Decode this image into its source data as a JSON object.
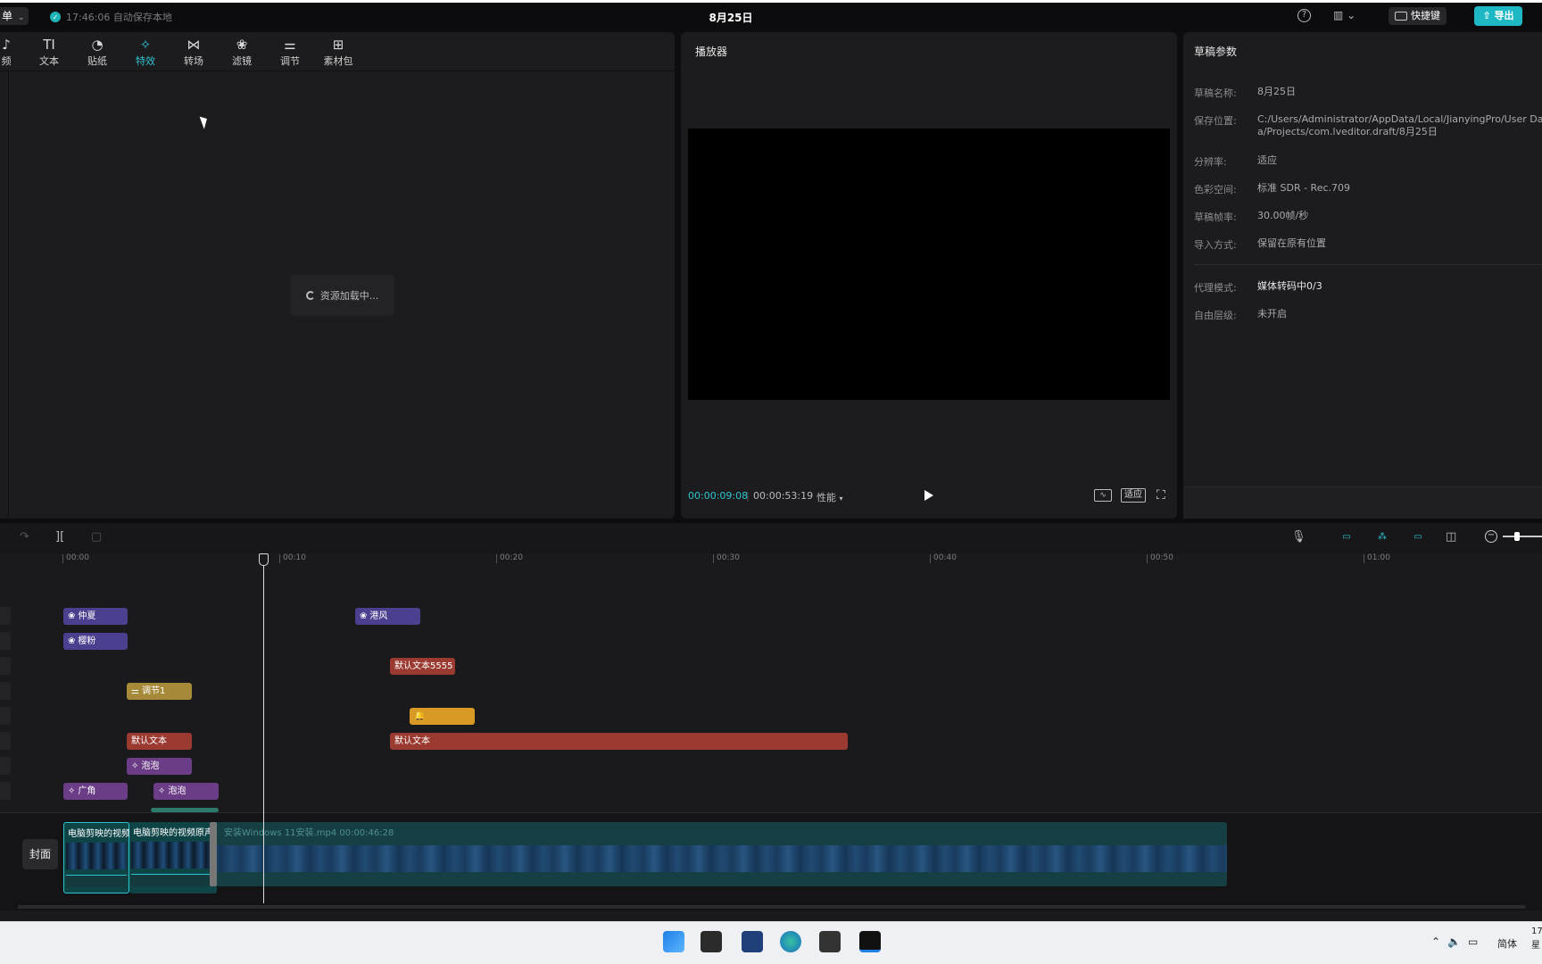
{
  "titlebar": {
    "menu_label": "单",
    "autosave_text": "17:46:06 自动保存本地",
    "project_title": "8月25日",
    "shortcut_label": "快捷键",
    "export_label": "导出"
  },
  "tabs": [
    {
      "label": "频",
      "icon": "audio-icon"
    },
    {
      "label": "文本",
      "icon": "text-icon"
    },
    {
      "label": "贴纸",
      "icon": "sticker-icon"
    },
    {
      "label": "特效",
      "icon": "effects-icon",
      "active": true
    },
    {
      "label": "转场",
      "icon": "transition-icon"
    },
    {
      "label": "滤镜",
      "icon": "filter-icon"
    },
    {
      "label": "调节",
      "icon": "adjust-icon"
    },
    {
      "label": "素材包",
      "icon": "package-icon"
    }
  ],
  "left_panel": {
    "loading_text": "资源加载中..."
  },
  "player": {
    "title": "播放器",
    "current_time": "00:00:09:08",
    "total_time": "00:00:53:19",
    "perf_label": "性能",
    "fit_label": "适应"
  },
  "draft": {
    "title": "草稿参数",
    "rows": [
      {
        "key": "草稿名称:",
        "value": "8月25日"
      },
      {
        "key": "保存位置:",
        "value": "C:/Users/Administrator/AppData/Local/JianyingPro/User Data/Projects/com.lveditor.draft/8月25日"
      },
      {
        "key": "分辨率:",
        "value": "适应"
      },
      {
        "key": "色彩空间:",
        "value": "标准 SDR - Rec.709"
      },
      {
        "key": "草稿帧率:",
        "value": "30.00帧/秒"
      },
      {
        "key": "导入方式:",
        "value": "保留在原有位置"
      },
      {
        "key": "代理模式:",
        "value": "媒体转码中0/3"
      },
      {
        "key": "自由层级:",
        "value": "未开启"
      }
    ]
  },
  "ruler": [
    "00:00",
    "00:10",
    "00:20",
    "00:30",
    "00:40",
    "00:50",
    "01:00"
  ],
  "clips": {
    "c1": "仲夏",
    "c2": "港风",
    "c3": "樱粉",
    "c4": "默认文本5555",
    "c5": "调节1",
    "c6": "默认文本",
    "c7": "默认文本",
    "c8": "泡泡",
    "c9": "广角",
    "c10": "泡泡"
  },
  "main_track": {
    "cover_label": "封面",
    "clip_a": "电脑剪映的视频",
    "clip_b": "电脑剪映的视频原声",
    "video_label": "安装Windows 11安装.mp4   00:00:46:28"
  },
  "taskbar": {
    "lang": "简体",
    "time": "17",
    "date": "星"
  }
}
